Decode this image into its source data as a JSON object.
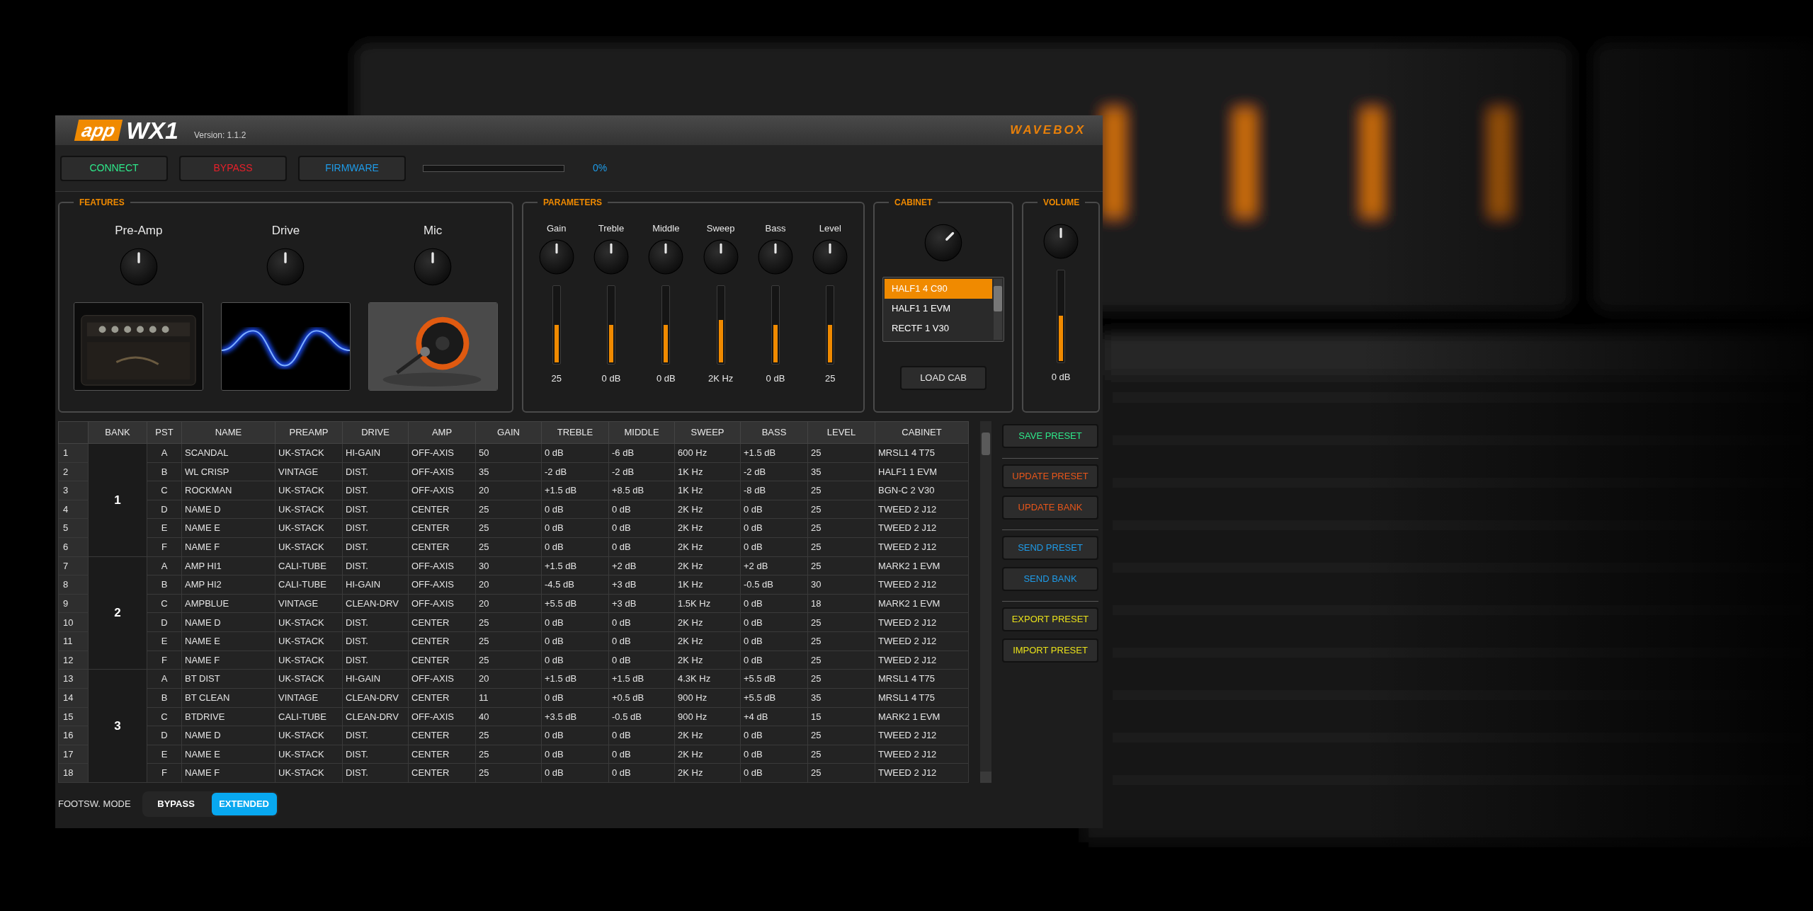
{
  "header": {
    "logo_badge": "app",
    "logo_model": "WX1",
    "version": "Version: 1.1.2",
    "brand": "WAVEBOX"
  },
  "toolbar": {
    "buttons": [
      {
        "label": "CONNECT",
        "color": "#2ee88a"
      },
      {
        "label": "BYPASS",
        "color": "#e8202a"
      },
      {
        "label": "FIRMWARE",
        "color": "#1e9be8"
      }
    ],
    "progress": {
      "level": 0,
      "reading": "0%"
    }
  },
  "features": {
    "title": "FEATURES",
    "items": [
      {
        "label": "Pre-Amp"
      },
      {
        "label": "Drive"
      },
      {
        "label": "Mic"
      }
    ]
  },
  "parameters": {
    "title": "PARAMETERS",
    "items": [
      {
        "label": "Gain",
        "slider": {
          "level": 0.5
        },
        "reading": "25"
      },
      {
        "label": "Treble",
        "slider": {
          "level": 0.5
        },
        "reading": "0 dB"
      },
      {
        "label": "Middle",
        "slider": {
          "level": 0.5
        },
        "reading": "0 dB"
      },
      {
        "label": "Sweep",
        "slider": {
          "level": 0.57
        },
        "reading": "2K Hz"
      },
      {
        "label": "Bass",
        "slider": {
          "level": 0.5
        },
        "reading": "0 dB"
      },
      {
        "label": "Level",
        "slider": {
          "level": 0.5
        },
        "reading": "25"
      }
    ]
  },
  "cabinet": {
    "title": "CABINET",
    "list": [
      {
        "label": "HALF1 4 C90",
        "selected": true
      },
      {
        "label": "HALF1 1 EVM",
        "selected": false
      },
      {
        "label": "RECTF 1 V30",
        "selected": false
      }
    ],
    "button": "LOAD CAB"
  },
  "volume": {
    "title": "VOLUME",
    "slider": {
      "level": 0.51
    },
    "reading": "0 dB"
  },
  "table": {
    "columns": [
      "BANK",
      "PST",
      "NAME",
      "PREAMP",
      "DRIVE",
      "AMP",
      "GAIN",
      "TREBLE",
      "MIDDLE",
      "SWEEP",
      "BASS",
      "LEVEL",
      "CABINET"
    ],
    "banks": [
      {
        "bank": "1",
        "rows": [
          {
            "num": "1",
            "cells": [
              "A",
              "SCANDAL",
              "UK-STACK",
              "HI-GAIN",
              "OFF-AXIS",
              "50",
              "0 dB",
              "-6 dB",
              "600 Hz",
              "+1.5 dB",
              "25",
              "MRSL1 4 T75"
            ]
          },
          {
            "num": "2",
            "cells": [
              "B",
              "WL CRISP",
              "VINTAGE",
              "DIST.",
              "OFF-AXIS",
              "35",
              "-2 dB",
              "-2 dB",
              "1K Hz",
              "-2 dB",
              "35",
              "HALF1 1 EVM"
            ]
          },
          {
            "num": "3",
            "cells": [
              "C",
              "ROCKMAN",
              "UK-STACK",
              "DIST.",
              "OFF-AXIS",
              "20",
              "+1.5 dB",
              "+8.5 dB",
              "1K Hz",
              "-8 dB",
              "25",
              "BGN-C 2 V30"
            ]
          },
          {
            "num": "4",
            "cells": [
              "D",
              "NAME D",
              "UK-STACK",
              "DIST.",
              "CENTER",
              "25",
              "0 dB",
              "0 dB",
              "2K Hz",
              "0 dB",
              "25",
              "TWEED 2 J12"
            ]
          },
          {
            "num": "5",
            "cells": [
              "E",
              "NAME E",
              "UK-STACK",
              "DIST.",
              "CENTER",
              "25",
              "0 dB",
              "0 dB",
              "2K Hz",
              "0 dB",
              "25",
              "TWEED 2 J12"
            ]
          },
          {
            "num": "6",
            "cells": [
              "F",
              "NAME F",
              "UK-STACK",
              "DIST.",
              "CENTER",
              "25",
              "0 dB",
              "0 dB",
              "2K Hz",
              "0 dB",
              "25",
              "TWEED 2 J12"
            ]
          }
        ]
      },
      {
        "bank": "2",
        "rows": [
          {
            "num": "7",
            "cells": [
              "A",
              "AMP HI1",
              "CALI-TUBE",
              "DIST.",
              "OFF-AXIS",
              "30",
              "+1.5 dB",
              "+2 dB",
              "2K Hz",
              "+2 dB",
              "25",
              "MARK2 1 EVM"
            ]
          },
          {
            "num": "8",
            "cells": [
              "B",
              "AMP HI2",
              "CALI-TUBE",
              "HI-GAIN",
              "OFF-AXIS",
              "20",
              "-4.5 dB",
              "+3 dB",
              "1K Hz",
              "-0.5 dB",
              "30",
              "TWEED 2 J12"
            ]
          },
          {
            "num": "9",
            "cells": [
              "C",
              "AMPBLUE",
              "VINTAGE",
              "CLEAN-DRV",
              "OFF-AXIS",
              "20",
              "+5.5 dB",
              "+3 dB",
              "1.5K Hz",
              "0 dB",
              "18",
              "MARK2 1 EVM"
            ]
          },
          {
            "num": "10",
            "cells": [
              "D",
              "NAME D",
              "UK-STACK",
              "DIST.",
              "CENTER",
              "25",
              "0 dB",
              "0 dB",
              "2K Hz",
              "0 dB",
              "25",
              "TWEED 2 J12"
            ]
          },
          {
            "num": "11",
            "cells": [
              "E",
              "NAME E",
              "UK-STACK",
              "DIST.",
              "CENTER",
              "25",
              "0 dB",
              "0 dB",
              "2K Hz",
              "0 dB",
              "25",
              "TWEED 2 J12"
            ]
          },
          {
            "num": "12",
            "cells": [
              "F",
              "NAME F",
              "UK-STACK",
              "DIST.",
              "CENTER",
              "25",
              "0 dB",
              "0 dB",
              "2K Hz",
              "0 dB",
              "25",
              "TWEED 2 J12"
            ]
          }
        ]
      },
      {
        "bank": "3",
        "rows": [
          {
            "num": "13",
            "cells": [
              "A",
              "BT DIST",
              "UK-STACK",
              "HI-GAIN",
              "OFF-AXIS",
              "20",
              "+1.5 dB",
              "+1.5 dB",
              "4.3K Hz",
              "+5.5 dB",
              "25",
              "MRSL1 4 T75"
            ]
          },
          {
            "num": "14",
            "cells": [
              "B",
              "BT CLEAN",
              "VINTAGE",
              "CLEAN-DRV",
              "CENTER",
              "11",
              "0 dB",
              "+0.5 dB",
              "900 Hz",
              "+5.5 dB",
              "35",
              "MRSL1 4 T75"
            ]
          },
          {
            "num": "15",
            "cells": [
              "C",
              "BTDRIVE",
              "CALI-TUBE",
              "CLEAN-DRV",
              "OFF-AXIS",
              "40",
              "+3.5 dB",
              "-0.5 dB",
              "900 Hz",
              "+4 dB",
              "15",
              "MARK2 1 EVM"
            ]
          },
          {
            "num": "16",
            "cells": [
              "D",
              "NAME D",
              "UK-STACK",
              "DIST.",
              "CENTER",
              "25",
              "0 dB",
              "0 dB",
              "2K Hz",
              "0 dB",
              "25",
              "TWEED 2 J12"
            ]
          },
          {
            "num": "17",
            "cells": [
              "E",
              "NAME E",
              "UK-STACK",
              "DIST.",
              "CENTER",
              "25",
              "0 dB",
              "0 dB",
              "2K Hz",
              "0 dB",
              "25",
              "TWEED 2 J12"
            ]
          },
          {
            "num": "18",
            "cells": [
              "F",
              "NAME F",
              "UK-STACK",
              "DIST.",
              "CENTER",
              "25",
              "0 dB",
              "0 dB",
              "2K Hz",
              "0 dB",
              "25",
              "TWEED 2 J12"
            ]
          }
        ]
      }
    ]
  },
  "side_buttons": [
    [
      {
        "label": "SAVE PRESET",
        "color": "#2ee88a"
      }
    ],
    [
      {
        "label": "UPDATE PRESET",
        "color": "#e8561a"
      },
      {
        "label": "UPDATE BANK",
        "color": "#e8561a"
      }
    ],
    [
      {
        "label": "SEND PRESET",
        "color": "#1e9be8"
      },
      {
        "label": "SEND BANK",
        "color": "#1e9be8"
      }
    ],
    [
      {
        "label": "EXPORT PRESET",
        "color": "#e8e01a"
      },
      {
        "label": "IMPORT PRESET",
        "color": "#e8e01a"
      }
    ]
  ],
  "footer": {
    "label": "FOOTSW. MODE",
    "options": [
      {
        "label": "BYPASS",
        "selected": false
      },
      {
        "label": "EXTENDED",
        "selected": true
      }
    ]
  }
}
